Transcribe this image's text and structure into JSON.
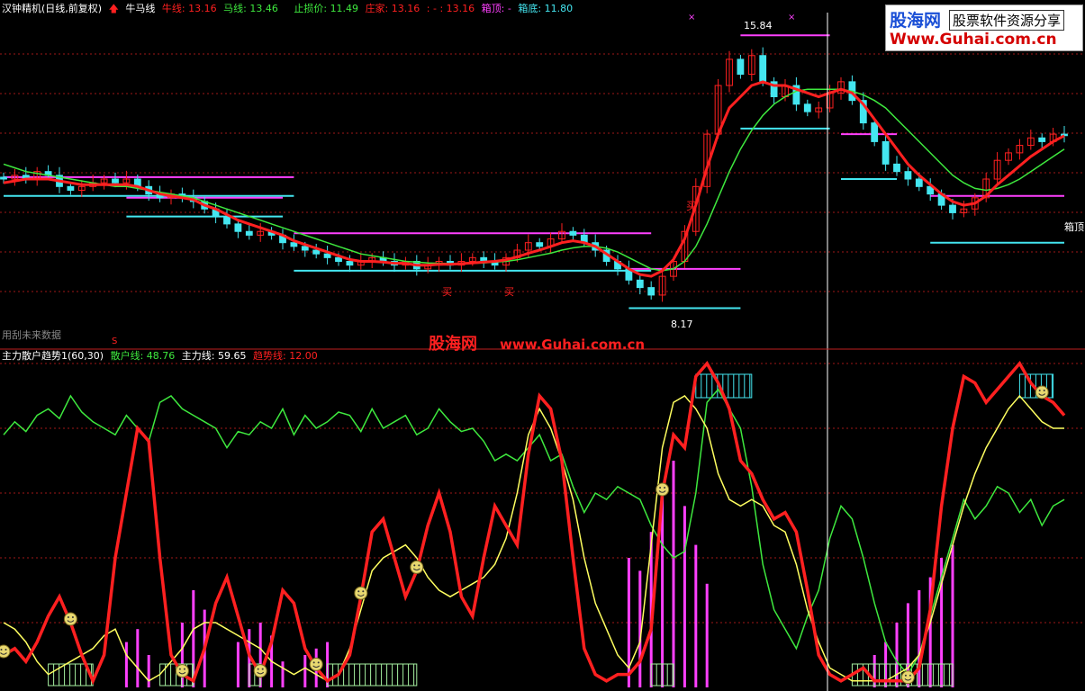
{
  "header_main": {
    "name": "汉钟精机(日线,前复权)",
    "indicator": "牛马线",
    "niu_label": "牛线:",
    "niu_value": "13.16",
    "ma_label": "马线:",
    "ma_value": "13.46",
    "stop_label": "止损价:",
    "stop_value": "11.49",
    "zj_label": "庄家:",
    "zj_value": "13.16",
    "sep": ": - :",
    "val2": "13.16",
    "xt_label": "箱顶:",
    "xt_value": "-",
    "xd_label": "箱底:",
    "xd_value": "11.80"
  },
  "header_sub": {
    "name": "主力散户趋势1(60,30)",
    "sh_label": "散户线:",
    "sh_value": "48.76",
    "zl_label": "主力线:",
    "zl_value": "59.65",
    "qs_label": "趋势线:",
    "qs_value": "12.00"
  },
  "annotations": {
    "high": "15.84",
    "low": "8.17",
    "box_top": "箱顶",
    "future": "用刮未来数据",
    "buy": "买",
    "s_mark": "S",
    "x_mark": "×"
  },
  "watermark": {
    "brand": "股海网",
    "slogan": "股票软件资源分享",
    "url": "Www.Guhai.com.cn",
    "mid_cn": "股海网",
    "mid_url": "www.Guhai.com.cn"
  },
  "colors": {
    "red": "#ff2020",
    "green": "#3ee83e",
    "yellow": "#ffff60",
    "cyan": "#44e6f0",
    "magenta": "#ff40ff",
    "grid": "#a01818",
    "lightgreen": "#a6f0a0"
  },
  "chart_data": [
    {
      "type": "candlestick",
      "ylim": [
        7.6,
        16.4
      ],
      "x": [
        0,
        95
      ],
      "close": [
        12.0,
        12.1,
        12.0,
        12.2,
        12.1,
        11.8,
        11.7,
        11.8,
        11.9,
        12.0,
        11.9,
        12.0,
        11.8,
        11.6,
        11.5,
        11.6,
        11.5,
        11.4,
        11.2,
        11.0,
        10.8,
        10.6,
        10.5,
        10.6,
        10.5,
        10.3,
        10.2,
        10.1,
        10.0,
        9.9,
        9.8,
        9.7,
        9.8,
        9.9,
        9.8,
        9.7,
        9.8,
        9.6,
        9.7,
        9.8,
        9.7,
        9.8,
        9.9,
        9.8,
        9.7,
        9.9,
        10.1,
        10.3,
        10.2,
        10.4,
        10.6,
        10.5,
        10.3,
        10.1,
        9.8,
        9.6,
        9.3,
        9.1,
        8.9,
        9.4,
        9.8,
        10.6,
        11.8,
        13.2,
        14.5,
        15.2,
        14.8,
        15.3,
        14.6,
        14.2,
        14.5,
        14.0,
        13.8,
        13.9,
        14.3,
        14.6,
        14.1,
        13.5,
        13.0,
        12.4,
        12.2,
        12.0,
        11.8,
        11.6,
        11.3,
        11.1,
        11.2,
        11.5,
        12.0,
        12.5,
        12.7,
        12.9,
        13.1,
        13.0,
        13.2,
        13.16
      ],
      "ma_niu": [
        11.9,
        11.95,
        12.0,
        12.0,
        12.0,
        11.95,
        11.9,
        11.85,
        11.85,
        11.85,
        11.85,
        11.85,
        11.8,
        11.7,
        11.6,
        11.55,
        11.5,
        11.45,
        11.3,
        11.2,
        11.05,
        10.9,
        10.8,
        10.7,
        10.6,
        10.5,
        10.35,
        10.25,
        10.15,
        10.05,
        9.95,
        9.85,
        9.8,
        9.8,
        9.78,
        9.75,
        9.75,
        9.7,
        9.7,
        9.72,
        9.72,
        9.74,
        9.76,
        9.78,
        9.8,
        9.84,
        9.92,
        10.02,
        10.1,
        10.2,
        10.3,
        10.35,
        10.3,
        10.2,
        10.0,
        9.8,
        9.6,
        9.45,
        9.4,
        9.55,
        9.85,
        10.4,
        11.3,
        12.3,
        13.2,
        13.9,
        14.2,
        14.5,
        14.6,
        14.5,
        14.5,
        14.4,
        14.3,
        14.2,
        14.3,
        14.4,
        14.3,
        14.0,
        13.6,
        13.2,
        12.8,
        12.4,
        12.1,
        11.85,
        11.6,
        11.4,
        11.3,
        11.35,
        11.55,
        11.85,
        12.1,
        12.35,
        12.6,
        12.8,
        13.0,
        13.16
      ],
      "ma_ma": [
        12.4,
        12.3,
        12.2,
        12.15,
        12.1,
        12.05,
        12.0,
        11.95,
        11.9,
        11.85,
        11.8,
        11.8,
        11.75,
        11.7,
        11.65,
        11.6,
        11.55,
        11.5,
        11.4,
        11.3,
        11.2,
        11.1,
        11.0,
        10.9,
        10.8,
        10.7,
        10.6,
        10.5,
        10.4,
        10.3,
        10.2,
        10.1,
        10.0,
        9.95,
        9.9,
        9.85,
        9.8,
        9.78,
        9.76,
        9.75,
        9.74,
        9.74,
        9.75,
        9.76,
        9.78,
        9.8,
        9.84,
        9.9,
        9.96,
        10.02,
        10.1,
        10.16,
        10.2,
        10.2,
        10.15,
        10.05,
        9.9,
        9.75,
        9.6,
        9.55,
        9.6,
        9.8,
        10.2,
        10.8,
        11.5,
        12.2,
        12.8,
        13.3,
        13.7,
        14.0,
        14.2,
        14.35,
        14.4,
        14.4,
        14.4,
        14.4,
        14.35,
        14.25,
        14.1,
        13.9,
        13.6,
        13.3,
        13.0,
        12.7,
        12.4,
        12.1,
        11.9,
        11.75,
        11.7,
        11.75,
        11.85,
        12.0,
        12.2,
        12.4,
        12.6,
        12.8
      ]
    },
    {
      "type": "line",
      "ylim": [
        0,
        100
      ],
      "x": [
        0,
        95
      ],
      "series": [
        {
          "name": "散户线",
          "values": [
            78,
            82,
            79,
            84,
            86,
            83,
            90,
            85,
            82,
            80,
            78,
            84,
            80,
            76,
            88,
            90,
            86,
            84,
            82,
            80,
            74,
            79,
            78,
            82,
            80,
            86,
            78,
            84,
            80,
            82,
            85,
            84,
            79,
            86,
            80,
            82,
            84,
            78,
            80,
            86,
            82,
            79,
            80,
            76,
            70,
            72,
            70,
            74,
            78,
            70,
            72,
            62,
            54,
            60,
            58,
            62,
            60,
            58,
            50,
            44,
            40,
            42,
            60,
            88,
            92,
            86,
            80,
            62,
            38,
            24,
            18,
            12,
            22,
            30,
            46,
            56,
            52,
            40,
            26,
            14,
            8,
            4,
            10,
            22,
            34,
            46,
            58,
            52,
            56,
            62,
            60,
            54,
            58,
            50,
            56,
            58
          ]
        },
        {
          "name": "主力线",
          "values": [
            20,
            18,
            14,
            8,
            4,
            6,
            8,
            10,
            12,
            16,
            18,
            10,
            6,
            2,
            4,
            8,
            12,
            18,
            20,
            20,
            18,
            16,
            14,
            12,
            8,
            6,
            4,
            6,
            4,
            2,
            4,
            12,
            24,
            36,
            40,
            42,
            44,
            40,
            34,
            30,
            28,
            30,
            32,
            34,
            38,
            46,
            60,
            78,
            86,
            80,
            70,
            58,
            40,
            26,
            18,
            10,
            6,
            14,
            44,
            74,
            88,
            90,
            86,
            80,
            66,
            58,
            56,
            58,
            56,
            50,
            48,
            38,
            24,
            14,
            6,
            4,
            2,
            2,
            2,
            2,
            4,
            6,
            10,
            20,
            32,
            44,
            56,
            66,
            74,
            80,
            86,
            90,
            86,
            82,
            80,
            80
          ]
        },
        {
          "name": "趋势线",
          "values": [
            10,
            12,
            8,
            14,
            22,
            28,
            20,
            10,
            2,
            10,
            40,
            60,
            80,
            76,
            40,
            10,
            4,
            2,
            12,
            26,
            34,
            22,
            10,
            4,
            14,
            30,
            26,
            12,
            6,
            2,
            4,
            10,
            28,
            48,
            52,
            40,
            28,
            36,
            50,
            60,
            48,
            28,
            22,
            40,
            56,
            50,
            44,
            72,
            90,
            86,
            70,
            40,
            12,
            4,
            2,
            4,
            4,
            8,
            18,
            60,
            78,
            74,
            96,
            100,
            94,
            86,
            70,
            66,
            58,
            52,
            54,
            48,
            30,
            10,
            4,
            2,
            4,
            6,
            2,
            2,
            2,
            2,
            6,
            24,
            56,
            80,
            96,
            94,
            88,
            92,
            96,
            100,
            94,
            90,
            88,
            84
          ]
        },
        {
          "name": "柱",
          "values": [
            0,
            0,
            0,
            0,
            0,
            0,
            0,
            0,
            0,
            0,
            0,
            14,
            18,
            10,
            0,
            0,
            20,
            30,
            24,
            0,
            0,
            14,
            18,
            20,
            16,
            8,
            0,
            10,
            12,
            14,
            0,
            0,
            0,
            0,
            0,
            0,
            0,
            0,
            0,
            0,
            0,
            0,
            0,
            0,
            0,
            0,
            0,
            0,
            0,
            0,
            0,
            0,
            0,
            0,
            0,
            0,
            40,
            36,
            48,
            60,
            70,
            56,
            44,
            32,
            0,
            0,
            0,
            0,
            0,
            0,
            0,
            0,
            0,
            0,
            0,
            0,
            0,
            0,
            10,
            14,
            20,
            26,
            30,
            34,
            40,
            44,
            0,
            0,
            0,
            0,
            0,
            0,
            0,
            0,
            0,
            0
          ]
        }
      ]
    }
  ]
}
